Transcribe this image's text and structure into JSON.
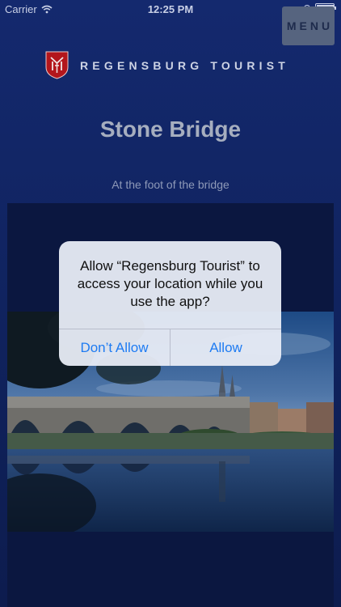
{
  "status_bar": {
    "carrier": "Carrier",
    "time": "12:25 PM"
  },
  "menu": {
    "label": "MENU"
  },
  "header": {
    "brand_name": "REGENSBURG TOURIST",
    "title": "Stone Bridge",
    "subtitle": "At the foot of the bridge"
  },
  "alert": {
    "message": "Allow “Regensburg Tourist” to access your location while you use the app?",
    "dont_allow": "Don’t Allow",
    "allow": "Allow"
  },
  "colors": {
    "background": "#14296e",
    "alert_button": "#1e7bf2"
  }
}
